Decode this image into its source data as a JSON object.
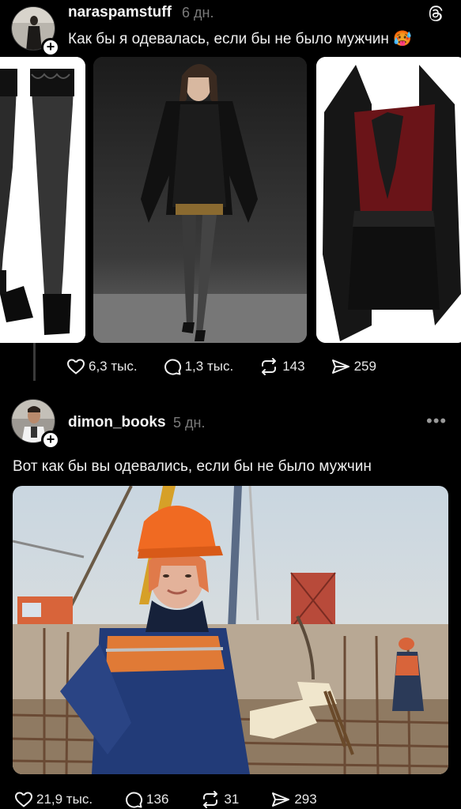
{
  "posts": [
    {
      "username": "naraspamstuff",
      "time": "6 дн.",
      "caption": "Как бы я одевалась, если бы не было мужчин 🥵",
      "likes": "6,3 тыс.",
      "comments": "1,3 тыс.",
      "reposts": "143",
      "shares": "259"
    },
    {
      "username": "dimon_books",
      "time": "5 дн.",
      "caption": "Вот как бы вы одевались, если бы не было мужчин",
      "likes": "21,9 тыс.",
      "comments": "136",
      "reposts": "31",
      "shares": "293"
    }
  ],
  "icons": {
    "app": "threads-icon",
    "like": "heart-icon",
    "comment": "comment-icon",
    "repost": "repost-icon",
    "share": "share-icon",
    "more": "more-icon",
    "follow": "plus-icon"
  },
  "colors": {
    "background": "#000000",
    "text": "#f3f3f3",
    "secondary": "#7a7a7a",
    "badge": "#ffffff"
  }
}
